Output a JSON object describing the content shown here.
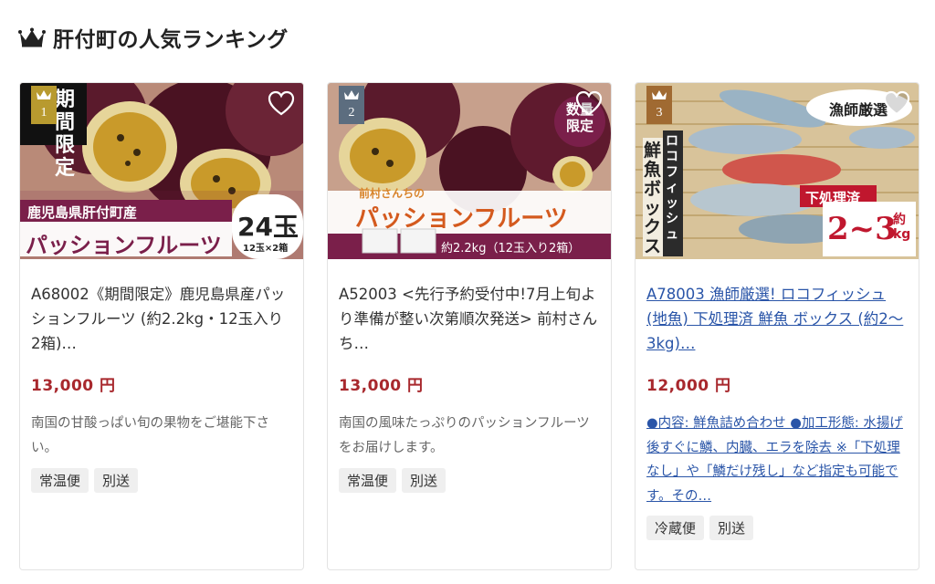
{
  "section": {
    "title": "肝付町の人気ランキング"
  },
  "products": [
    {
      "rank": "1",
      "name": "A68002《期間限定》鹿児島県産パッションフルーツ (約2.2kg・12玉入り2箱)…",
      "price": "13,000 円",
      "description": "南国の甘酸っぱい旬の果物をご堪能下さい。",
      "tags": [
        "常温便",
        "別送"
      ],
      "image_text": {
        "corner": "期間限定",
        "origin": "鹿児島県肝付町産",
        "product": "パッションフルーツ",
        "count": "24玉",
        "count_sub": "12玉×2箱"
      },
      "link": false
    },
    {
      "rank": "2",
      "name": "A52003 <先行予約受付中!7月上旬より準備が整い次第順次発送> 前村さんち…",
      "price": "13,000 円",
      "description": "南国の風味たっぷりのパッションフルーツをお届けします。",
      "tags": [
        "常温便",
        "別送"
      ],
      "image_text": {
        "badge": "数量限定",
        "producer": "前村さんちの",
        "product": "パッションフルーツ",
        "weight": "約2.2kg（12玉入り2箱）"
      },
      "link": false
    },
    {
      "rank": "3",
      "name": "A78003 漁師厳選! ロコフィッシュ (地魚) 下処理済 鮮魚 ボックス (約2～3kg)…",
      "price": "12,000 円",
      "description": "●内容: 鮮魚詰め合わせ ●加工形態: 水揚げ後すぐに鱗、内臓、エラを除去 ※「下処理なし」や「鱗だけ残し」など指定も可能です。その…",
      "tags": [
        "冷蔵便",
        "別送"
      ],
      "image_text": {
        "corner": "漁師厳選",
        "vertical1": "ロコフィッシュ",
        "vertical2": "鮮魚ボックス",
        "processed": "下処理済",
        "weight_range": "2~3",
        "weight_unit": "約kg"
      },
      "link": true
    }
  ],
  "colors": {
    "price": "#a8282d",
    "link": "#2a55a8",
    "rank1": "#b89a2f",
    "rank2": "#5c6d7f",
    "rank3": "#a06a32",
    "banner_purple": "#7a1f4a"
  }
}
